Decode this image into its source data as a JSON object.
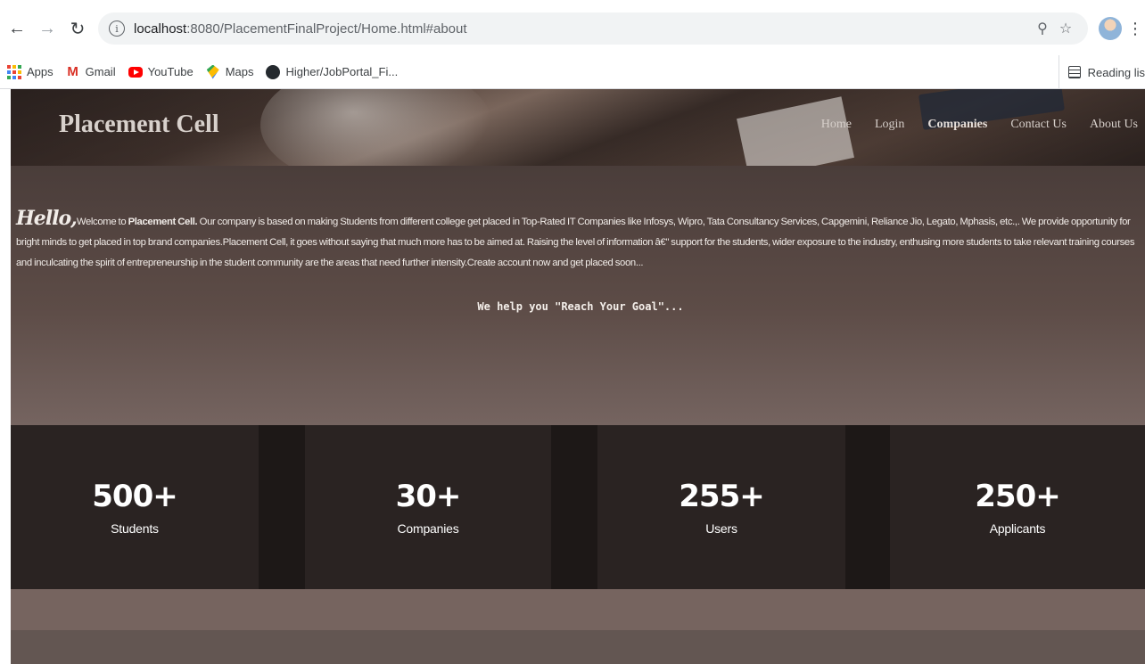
{
  "browser": {
    "url_host": "localhost",
    "url_path": ":8080/PlacementFinalProject/Home.html#about",
    "bookmarks": [
      {
        "label": "Apps",
        "icon": "apps-grid-icon"
      },
      {
        "label": "Gmail",
        "icon": "gmail-icon"
      },
      {
        "label": "YouTube",
        "icon": "youtube-icon"
      },
      {
        "label": "Maps",
        "icon": "maps-icon"
      },
      {
        "label": "Higher/JobPortal_Fi...",
        "icon": "github-icon"
      }
    ],
    "reading_list": "Reading lis"
  },
  "header": {
    "brand": "Placement Cell",
    "nav": [
      "Home",
      "Login",
      "Companies",
      "Contact Us",
      "About Us"
    ]
  },
  "about": {
    "hello": "Hello,",
    "intro": "Welcome to ",
    "company": "Placement Cell.",
    "body": " Our company is based on making Students from different college get placed in Top-Rated IT Companies like Infosys, Wipro, Tata Consultancy Services, Capgemini, Reliance Jio, Legato, Mphasis, etc.,. We provide opportunity for bright minds to get placed in top brand companies.Placement Cell, it goes without saying that much more has to be aimed at. Raising the level of information â€\" support for the students, wider exposure to the industry, enthusing more students to take relevant training courses and inculcating the spirit of entrepreneurship in the student community are the areas that need further intensity.Create account now and get placed soon...",
    "tagline": "We help you \"Reach Your Goal\"..."
  },
  "stats": [
    {
      "value": "500+",
      "label": "Students"
    },
    {
      "value": "30+",
      "label": "Companies"
    },
    {
      "value": "255+",
      "label": "Users"
    },
    {
      "value": "250+",
      "label": "Applicants"
    }
  ]
}
